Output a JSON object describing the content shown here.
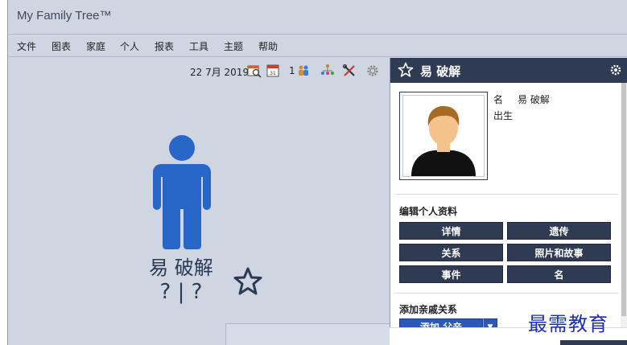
{
  "app": {
    "title": "My Family Tree™"
  },
  "menu": [
    "文件",
    "图表",
    "家庭",
    "个人",
    "报表",
    "工具",
    "主题",
    "帮助"
  ],
  "toolbar": {
    "date": "22 7月 2019",
    "count": "1",
    "icons": [
      "calendar-search-icon",
      "calendar-icon",
      "people-group-icon",
      "family-tree-icon",
      "tools-icon",
      "settings-gear-icon"
    ]
  },
  "person": {
    "name": "易 破解",
    "dates": "? | ?"
  },
  "panel": {
    "header_name": "易 破解",
    "facts": [
      {
        "label": "名",
        "value": "易 破解"
      },
      {
        "label": "出生",
        "value": ""
      }
    ],
    "edit_section": {
      "title": "编辑个人资料",
      "buttons": [
        "详情",
        "遗传",
        "关系",
        "照片和故事",
        "事件",
        "名"
      ]
    },
    "add_section": {
      "title": "添加亲戚关系",
      "button": "添加 父亲"
    }
  },
  "watermark": "最需教育",
  "colors": {
    "accent": "#2f3b52",
    "background": "#cfd6e2",
    "figure": "#2866c8",
    "add_button": "#2a59b8",
    "watermark": "#1a2fb0"
  }
}
